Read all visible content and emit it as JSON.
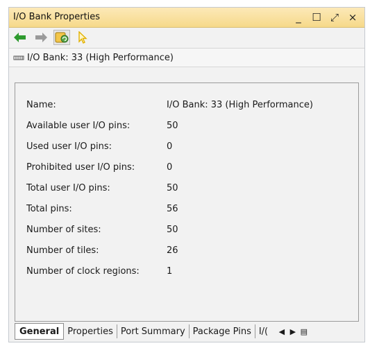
{
  "window": {
    "title": "I/O Bank Properties",
    "controls": {
      "minimize": "_",
      "maximize": "☐",
      "float": "⤢",
      "close": "×"
    }
  },
  "toolbar": {
    "icons": [
      "back-arrow",
      "forward-arrow",
      "auto-update",
      "select-pointer"
    ],
    "colors": {
      "back": "#2e9a2e",
      "forward": "#9a9a9a",
      "pointer": "#e2b100"
    }
  },
  "pathbar": {
    "text": "I/O Bank: 33 (High Performance)"
  },
  "properties": [
    {
      "label": "Name:",
      "value": "I/O Bank: 33 (High Performance)"
    },
    {
      "label": "Available user I/O pins:",
      "value": "50"
    },
    {
      "label": "Used user I/O pins:",
      "value": "0"
    },
    {
      "label": "Prohibited user I/O pins:",
      "value": "0"
    },
    {
      "label": "Total user I/O pins:",
      "value": "50"
    },
    {
      "label": "Total pins:",
      "value": "56"
    },
    {
      "label": "Number of sites:",
      "value": "50"
    },
    {
      "label": "Number of tiles:",
      "value": "26"
    },
    {
      "label": "Number of clock regions:",
      "value": "1"
    }
  ],
  "tabs": [
    "General",
    "Properties",
    "Port Summary",
    "Package Pins",
    "I/("
  ],
  "tab_nav": {
    "left": "◀",
    "right": "▶",
    "menu": "▤"
  }
}
